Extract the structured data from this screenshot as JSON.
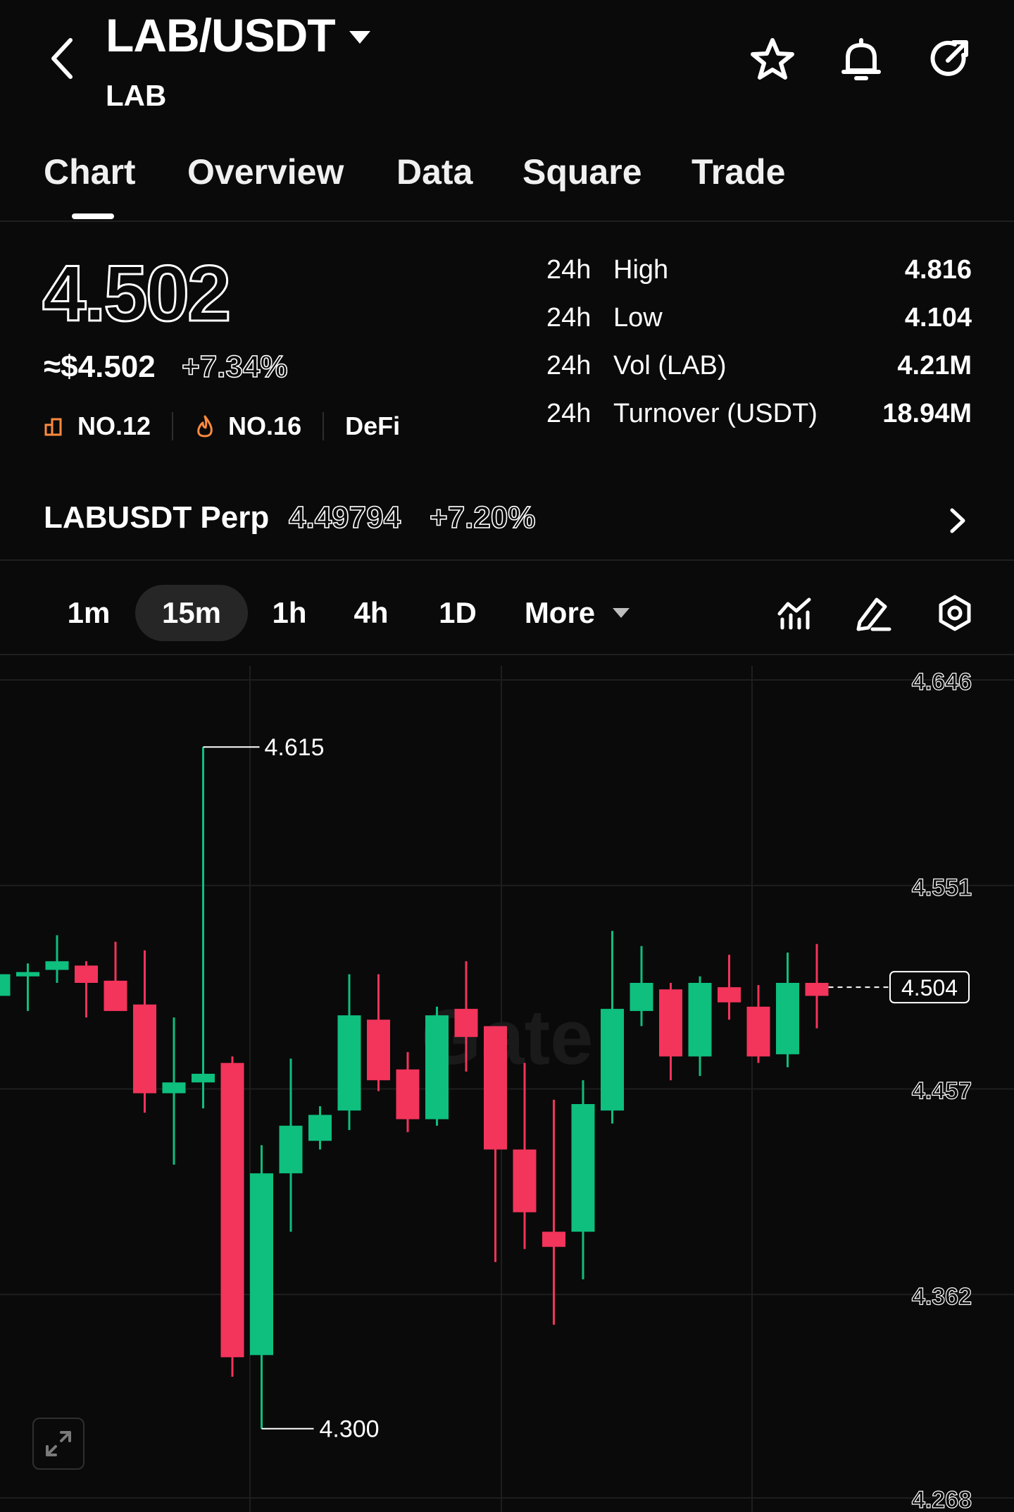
{
  "header": {
    "pair": "LAB/USDT",
    "base": "LAB",
    "icons": [
      "back-arrow-icon",
      "caret-down-icon",
      "star-icon",
      "bell-icon",
      "share-icon"
    ]
  },
  "tabs": [
    {
      "label": "Chart",
      "active": true
    },
    {
      "label": "Overview",
      "active": false
    },
    {
      "label": "Data",
      "active": false
    },
    {
      "label": "Square",
      "active": false
    },
    {
      "label": "Trade",
      "active": false
    }
  ],
  "price": {
    "last": "4.502",
    "usd": "≈$4.502",
    "change": "+7.34%",
    "rank1": "NO.12",
    "rank2": "NO.16",
    "sector": "DeFi"
  },
  "stats": [
    {
      "period": "24h",
      "label": "High",
      "value": "4.816"
    },
    {
      "period": "24h",
      "label": "Low",
      "value": "4.104"
    },
    {
      "period": "24h",
      "label": "Vol (LAB)",
      "value": "4.21M"
    },
    {
      "period": "24h",
      "label": "Turnover (USDT)",
      "value": "18.94M"
    }
  ],
  "perp": {
    "name": "LABUSDT Perp",
    "price": "4.49794",
    "change": "+7.20%"
  },
  "intervals": {
    "items": [
      "1m",
      "15m",
      "1h",
      "4h",
      "1D"
    ],
    "active": "15m",
    "more": "More"
  },
  "colors": {
    "up": "#0ebf7e",
    "down": "#f3345b",
    "background": "#0a0a0a",
    "grid": "#1e1e1e"
  },
  "chart_data": {
    "type": "candlestick",
    "interval": "15m",
    "ylim": [
      4.268,
      4.646
    ],
    "y_ticks": [
      "4.646",
      "4.551",
      "4.457",
      "4.362",
      "4.268"
    ],
    "current_price_label": "4.504",
    "current_price": 4.504,
    "max_label": "4.615",
    "min_label": "4.300",
    "watermark": "Gate",
    "candles": [
      {
        "o": 4.5,
        "c": 4.51,
        "h": 4.516,
        "l": 4.482
      },
      {
        "o": 4.509,
        "c": 4.511,
        "h": 4.515,
        "l": 4.493
      },
      {
        "o": 4.512,
        "c": 4.516,
        "h": 4.528,
        "l": 4.506
      },
      {
        "o": 4.514,
        "c": 4.506,
        "h": 4.516,
        "l": 4.49
      },
      {
        "o": 4.507,
        "c": 4.493,
        "h": 4.525,
        "l": 4.493
      },
      {
        "o": 4.496,
        "c": 4.455,
        "h": 4.521,
        "l": 4.446
      },
      {
        "o": 4.455,
        "c": 4.46,
        "h": 4.49,
        "l": 4.422
      },
      {
        "o": 4.46,
        "c": 4.464,
        "h": 4.615,
        "l": 4.448
      },
      {
        "o": 4.469,
        "c": 4.333,
        "h": 4.472,
        "l": 4.324
      },
      {
        "o": 4.334,
        "c": 4.418,
        "h": 4.431,
        "l": 4.3
      },
      {
        "o": 4.418,
        "c": 4.44,
        "h": 4.471,
        "l": 4.391
      },
      {
        "o": 4.433,
        "c": 4.445,
        "h": 4.449,
        "l": 4.429
      },
      {
        "o": 4.447,
        "c": 4.491,
        "h": 4.51,
        "l": 4.438
      },
      {
        "o": 4.489,
        "c": 4.461,
        "h": 4.51,
        "l": 4.456
      },
      {
        "o": 4.466,
        "c": 4.443,
        "h": 4.474,
        "l": 4.437
      },
      {
        "o": 4.443,
        "c": 4.491,
        "h": 4.495,
        "l": 4.44
      },
      {
        "o": 4.494,
        "c": 4.481,
        "h": 4.516,
        "l": 4.465
      },
      {
        "o": 4.486,
        "c": 4.429,
        "h": 4.486,
        "l": 4.377
      },
      {
        "o": 4.429,
        "c": 4.4,
        "h": 4.469,
        "l": 4.383
      },
      {
        "o": 4.391,
        "c": 4.384,
        "h": 4.452,
        "l": 4.348
      },
      {
        "o": 4.391,
        "c": 4.45,
        "h": 4.461,
        "l": 4.369
      },
      {
        "o": 4.447,
        "c": 4.494,
        "h": 4.53,
        "l": 4.441
      },
      {
        "o": 4.493,
        "c": 4.506,
        "h": 4.523,
        "l": 4.486
      },
      {
        "o": 4.503,
        "c": 4.472,
        "h": 4.506,
        "l": 4.461
      },
      {
        "o": 4.472,
        "c": 4.506,
        "h": 4.509,
        "l": 4.463
      },
      {
        "o": 4.504,
        "c": 4.497,
        "h": 4.519,
        "l": 4.489
      },
      {
        "o": 4.495,
        "c": 4.472,
        "h": 4.505,
        "l": 4.469
      },
      {
        "o": 4.473,
        "c": 4.506,
        "h": 4.52,
        "l": 4.467
      },
      {
        "o": 4.506,
        "c": 4.5,
        "h": 4.524,
        "l": 4.485
      }
    ]
  }
}
